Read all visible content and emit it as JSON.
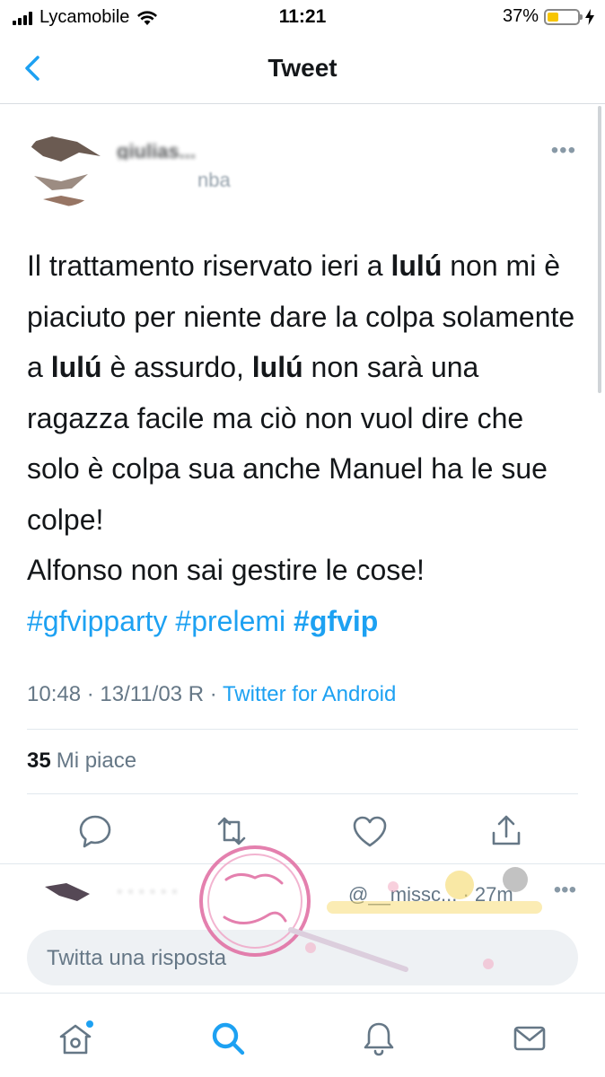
{
  "status_bar": {
    "carrier": "Lycamobile",
    "time": "11:21",
    "battery_percent": "37%",
    "battery_level": 0.37,
    "battery_color": "#f7c500"
  },
  "nav": {
    "title": "Tweet",
    "back_icon": "chevron-left-icon"
  },
  "tweet": {
    "author_name": "giulias...",
    "author_handle": "nba",
    "text_segments": [
      {
        "t": "Il trattamento riservato ieri a ",
        "style": "normal"
      },
      {
        "t": "lulú",
        "style": "bold"
      },
      {
        "t": "  non mi è piaciuto per niente dare la colpa solamente a ",
        "style": "normal"
      },
      {
        "t": "lulú",
        "style": "bold"
      },
      {
        "t": " è assurdo, ",
        "style": "normal"
      },
      {
        "t": "lulú",
        "style": "bold"
      },
      {
        "t": " non sarà una ragazza facile ma ciò non vuol dire che solo è colpa sua anche Manuel ha le sue colpe!",
        "style": "normal"
      }
    ],
    "text_line_2": "Alfonso non sai gestire le cose!",
    "hashtags": [
      "#gfvipparty",
      "#prelemi",
      "#gfvip"
    ],
    "meta": {
      "time": "10:48",
      "date": "13/11/03 R",
      "separator": " · ",
      "source": "Twitter for Android"
    },
    "likes": {
      "count": "35",
      "label": "Mi piace"
    },
    "actions": [
      "reply-icon",
      "retweet-icon",
      "like-icon",
      "share-icon"
    ]
  },
  "reply_preview": {
    "handle_time": "@__missc... · 27m"
  },
  "reply_box": {
    "placeholder": "Twitta una risposta"
  },
  "tab_bar": {
    "tabs": [
      "home-icon",
      "search-icon",
      "notifications-icon",
      "messages-icon"
    ],
    "active": "search-icon"
  },
  "colors": {
    "accent": "#1da1f2",
    "text": "#14171a",
    "muted": "#657786",
    "divider": "#e1e8ed"
  }
}
